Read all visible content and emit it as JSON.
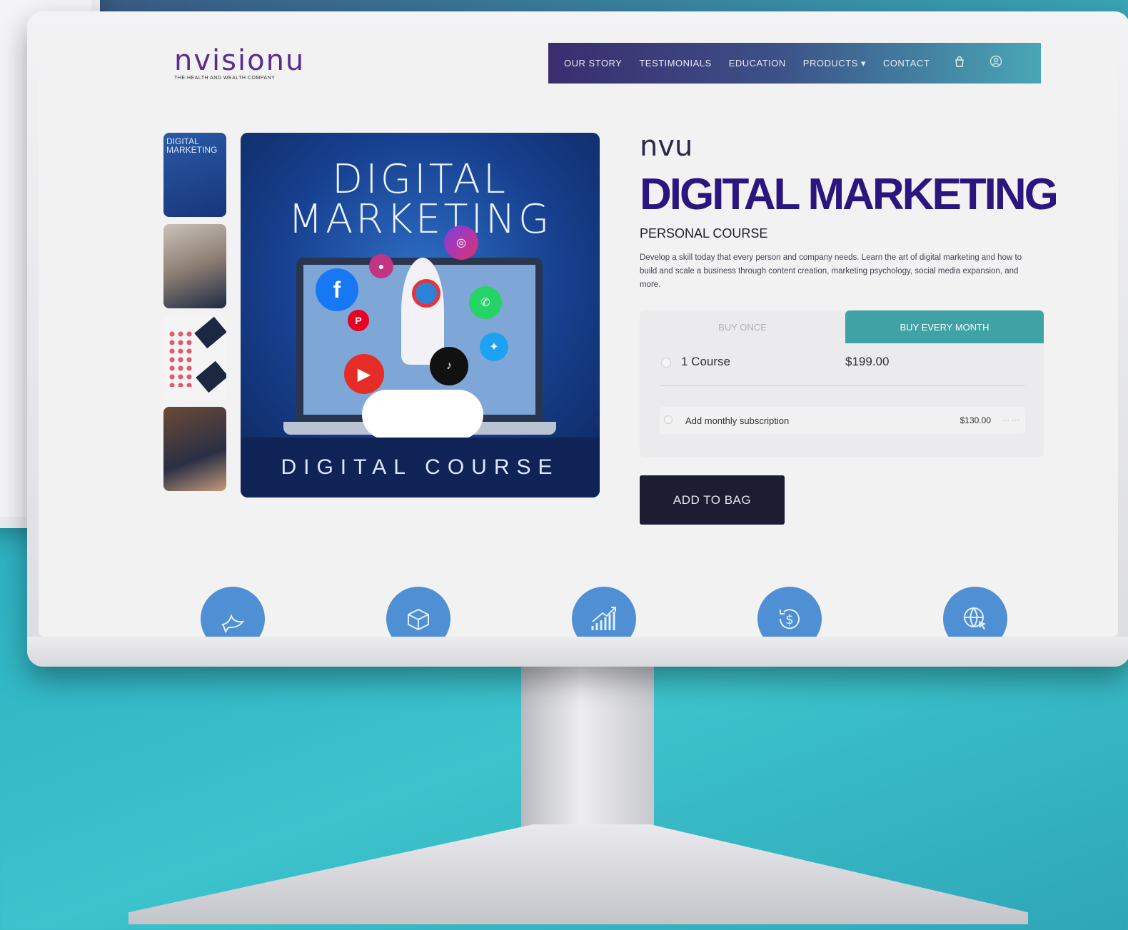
{
  "brand": {
    "logo_text": "nvisionu",
    "tagline": "THE HEALTH AND WEALTH COMPANY",
    "product_brand": "nvu"
  },
  "nav": {
    "items": [
      "OUR STORY",
      "TESTIMONIALS",
      "EDUCATION",
      "PRODUCTS ▾",
      "CONTACT"
    ],
    "icons": [
      "bag-icon",
      "user-icon"
    ]
  },
  "hero": {
    "title_line1": "DIGITAL",
    "title_line2": "MARKETING",
    "footer": "DIGITAL COURSE",
    "thumb1_text": "DIGITAL MARKETING"
  },
  "product": {
    "title": "DIGITAL MARKETING",
    "subtitle": "PERSONAL COURSE",
    "description": "Develop a skill today that every person and company needs. Learn the art of digital marketing and how to build and scale a business through content creation, marketing psychology, social media expansion, and more."
  },
  "purchase": {
    "tab_once": "BUY ONCE",
    "tab_month": "BUY EVERY MONTH",
    "option1_label": "1 Course",
    "option1_price": "$199.00",
    "option2_label": "Add monthly subscription",
    "option2_price": "$130.00"
  },
  "add_button": "ADD TO BAG",
  "features": [
    "dove-icon",
    "box-icon",
    "growth-chart-icon",
    "refund-icon",
    "globe-cursor-icon"
  ],
  "colors": {
    "accent": "#3fa2a4",
    "title": "#2b1680",
    "feature": "#4f8fd4",
    "button": "#1c1d33"
  }
}
